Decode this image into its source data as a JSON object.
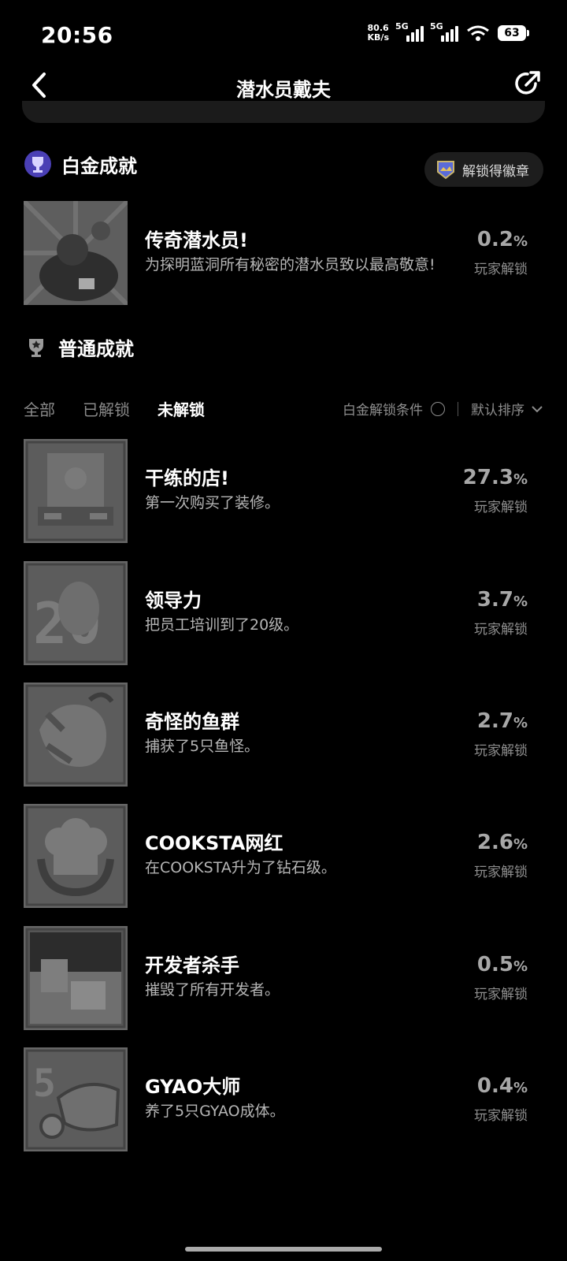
{
  "status": {
    "time": "20:56",
    "net_speed_value": "80.6",
    "net_speed_unit": "KB/s",
    "sim1": "5G",
    "sim2": "5G",
    "battery": "63"
  },
  "header": {
    "title": "潜水员戴夫"
  },
  "platinum": {
    "section_title": "白金成就",
    "badge_button": "解锁得徽章",
    "item": {
      "name": "传奇潜水员!",
      "desc": "为探明蓝洞所有秘密的潜水员致以最高敬意!",
      "percent": "0.2",
      "percent_suffix": "%",
      "unit": "玩家解锁"
    }
  },
  "normal": {
    "section_title": "普通成就",
    "tabs": [
      "全部",
      "已解锁",
      "未解锁"
    ],
    "active_tab": "未解锁",
    "condition_label": "白金解锁条件",
    "sort_label": "默认排序",
    "items": [
      {
        "name": "干练的店!",
        "desc": "第一次购买了装修。",
        "percent": "27.3",
        "percent_suffix": "%",
        "unit": "玩家解锁",
        "icon": "shop-icon"
      },
      {
        "name": "领导力",
        "desc": "把员工培训到了20级。",
        "percent": "3.7",
        "percent_suffix": "%",
        "unit": "玩家解锁",
        "icon": "leader-20-icon"
      },
      {
        "name": "奇怪的鱼群",
        "desc": "捕获了5只鱼怪。",
        "percent": "2.7",
        "percent_suffix": "%",
        "unit": "玩家解锁",
        "icon": "fish-monster-icon"
      },
      {
        "name": "COOKSTA网红",
        "desc": "在COOKSTA升为了钻石级。",
        "percent": "2.6",
        "percent_suffix": "%",
        "unit": "玩家解锁",
        "icon": "chef-hat-icon"
      },
      {
        "name": "开发者杀手",
        "desc": "摧毁了所有开发者。",
        "percent": "0.5",
        "percent_suffix": "%",
        "unit": "玩家解锁",
        "icon": "developer-icon"
      },
      {
        "name": "GYAO大师",
        "desc": "养了5只GYAO成体。",
        "percent": "0.4",
        "percent_suffix": "%",
        "unit": "玩家解锁",
        "icon": "gyao-5-icon"
      }
    ]
  }
}
